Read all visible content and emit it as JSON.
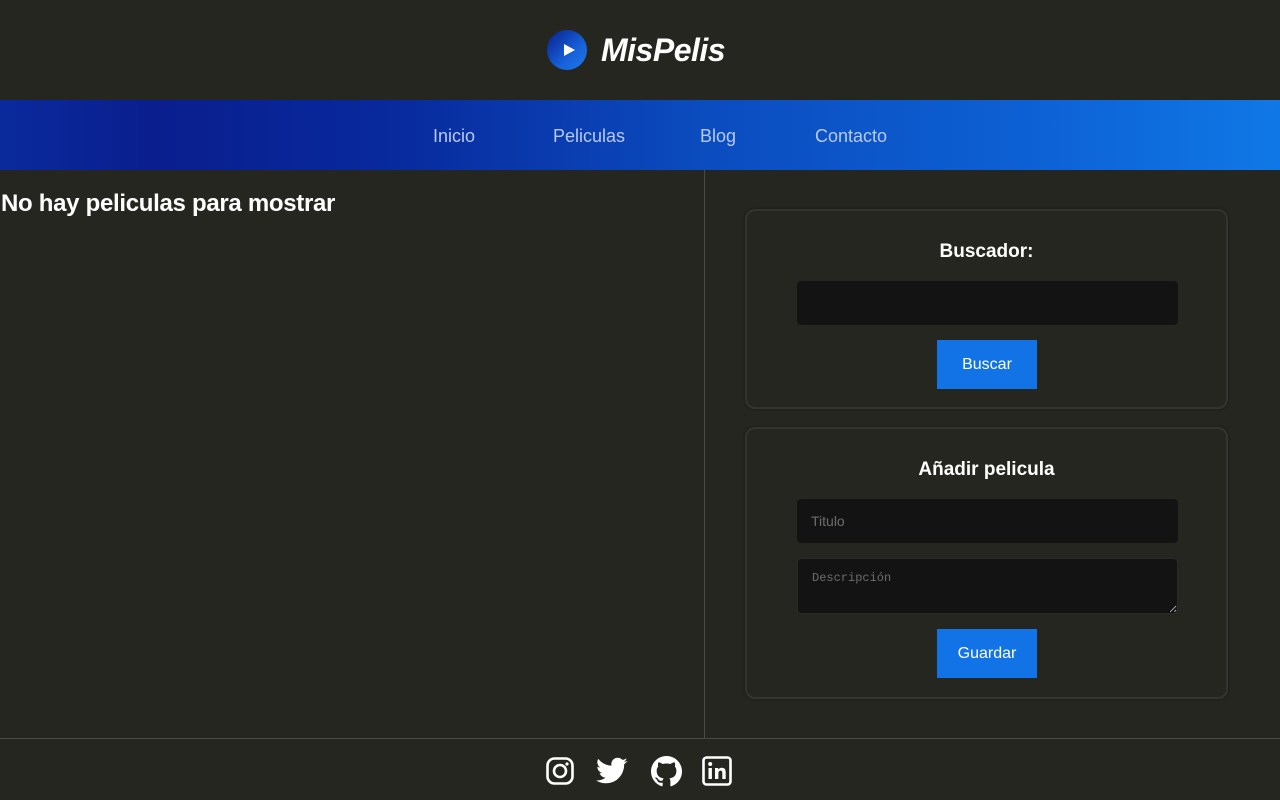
{
  "brand": {
    "name": "MisPelis",
    "icon": "play-icon",
    "accent": "#1173e6"
  },
  "nav": {
    "items": [
      {
        "label": "Inicio"
      },
      {
        "label": "Peliculas"
      },
      {
        "label": "Blog"
      },
      {
        "label": "Contacto"
      }
    ]
  },
  "content": {
    "empty_message": "No hay peliculas para mostrar"
  },
  "search": {
    "title": "Buscador:",
    "value": "",
    "placeholder": "",
    "button_label": "Buscar"
  },
  "add_movie": {
    "title": "Añadir pelicula",
    "title_placeholder": "Titulo",
    "description_placeholder": "Descripción",
    "button_label": "Guardar"
  },
  "footer": {
    "social": [
      "instagram-icon",
      "twitter-icon",
      "github-icon",
      "linkedin-icon"
    ]
  }
}
